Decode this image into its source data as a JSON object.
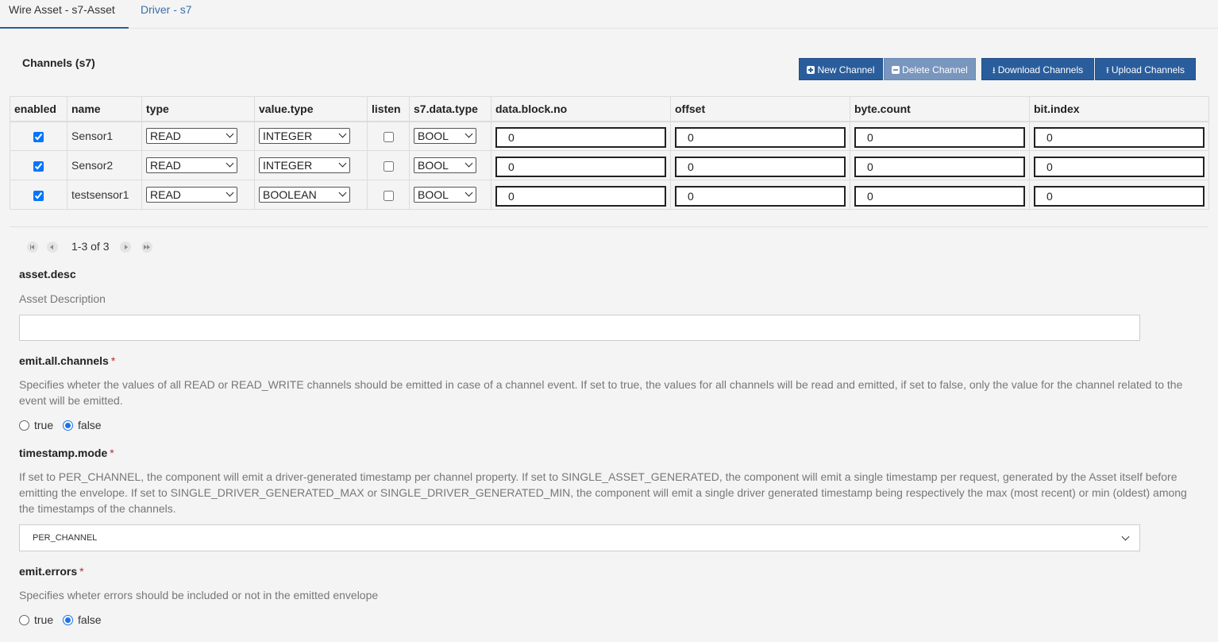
{
  "tabs": [
    {
      "label": "Wire Asset - s7-Asset",
      "active": true
    },
    {
      "label": "Driver - s7",
      "active": false
    }
  ],
  "section_title": "Channels (s7)",
  "toolbar": {
    "new_channel": "New Channel",
    "delete_channel": "Delete Channel",
    "download_channels": "Download Channels",
    "upload_channels": "Upload Channels"
  },
  "table": {
    "headers": [
      "enabled",
      "name",
      "type",
      "value.type",
      "listen",
      "s7.data.type",
      "data.block.no",
      "offset",
      "byte.count",
      "bit.index"
    ],
    "rows": [
      {
        "enabled": true,
        "name": "Sensor1",
        "type": "READ",
        "value_type": "INTEGER",
        "listen": false,
        "s7_data_type": "BOOL",
        "data_block_no": "0",
        "offset": "0",
        "byte_count": "0",
        "bit_index": "0"
      },
      {
        "enabled": true,
        "name": "Sensor2",
        "type": "READ",
        "value_type": "INTEGER",
        "listen": false,
        "s7_data_type": "BOOL",
        "data_block_no": "0",
        "offset": "0",
        "byte_count": "0",
        "bit_index": "0"
      },
      {
        "enabled": true,
        "name": "testsensor1",
        "type": "READ",
        "value_type": "BOOLEAN",
        "listen": false,
        "s7_data_type": "BOOL",
        "data_block_no": "0",
        "offset": "0",
        "byte_count": "0",
        "bit_index": "0"
      }
    ]
  },
  "pager": {
    "text": "1-3 of 3"
  },
  "fields": {
    "asset_desc": {
      "label": "asset.desc",
      "description": "Asset Description",
      "value": ""
    },
    "emit_all_channels": {
      "label": "emit.all.channels",
      "required": "*",
      "description": "Specifies wheter the values of all READ or READ_WRITE channels should be emitted in case of a channel event. If set to true, the values for all channels will be read and emitted, if set to false, only the value for the channel related to the event will be emitted.",
      "options": [
        "true",
        "false"
      ],
      "selected": "false"
    },
    "timestamp_mode": {
      "label": "timestamp.mode",
      "required": "*",
      "description": "If set to PER_CHANNEL, the component will emit a driver-generated timestamp per channel property. If set to SINGLE_ASSET_GENERATED, the component will emit a single timestamp per request, generated by the Asset itself before emitting the envelope. If set to SINGLE_DRIVER_GENERATED_MAX or SINGLE_DRIVER_GENERATED_MIN, the component will emit a single driver generated timestamp being respectively the max (most recent) or min (oldest) among the timestamps of the channels.",
      "value": "PER_CHANNEL"
    },
    "emit_errors": {
      "label": "emit.errors",
      "required": "*",
      "description": "Specifies wheter errors should be included or not in the emitted envelope",
      "options": [
        "true",
        "false"
      ],
      "selected": "false"
    }
  },
  "colors": {
    "accent": "#2a5d9c",
    "radio": "#1a73e8",
    "required": "#aa3333"
  }
}
